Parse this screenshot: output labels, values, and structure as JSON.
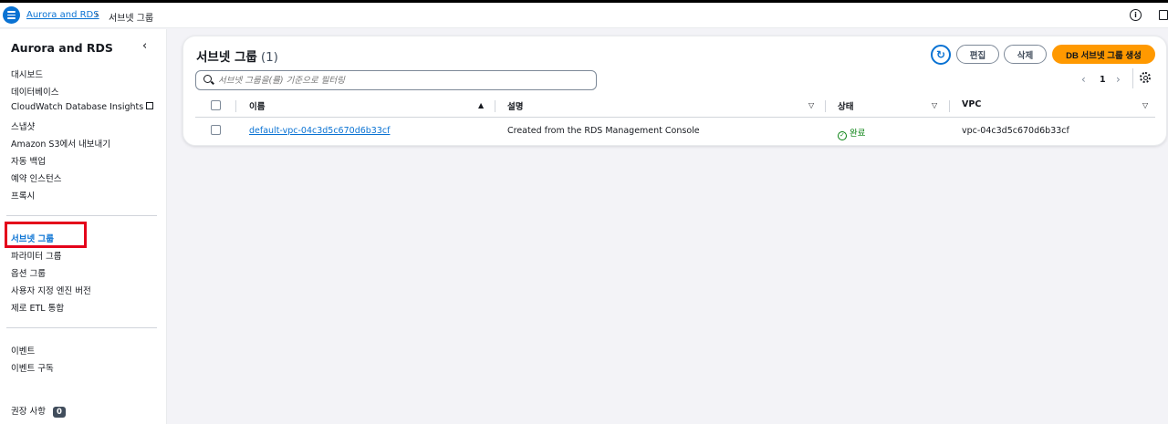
{
  "breadcrumb": {
    "parent": "Aurora and RDS",
    "separator": "›",
    "current": "서브넷 그룹"
  },
  "sidebar": {
    "title": "Aurora and RDS",
    "close_icon": "‹",
    "groups": [
      [
        "대시보드",
        "데이터베이스",
        "CloudWatch Database Insights",
        "스냅샷",
        "Amazon S3에서 내보내기",
        "자동 백업",
        "예약 인스턴스",
        "프록시"
      ],
      [
        "서브넷 그룹",
        "파라미터 그룹",
        "옵션 그룹",
        "사용자 지정 엔진 버전",
        "제로 ETL 통합"
      ],
      [
        "이벤트",
        "이벤트 구독"
      ],
      [
        "권장 사항"
      ]
    ],
    "active_item": "서브넷 그룹",
    "recommendations_count": "0"
  },
  "panel": {
    "title": "서브넷 그룹",
    "count": "(1)",
    "refresh_icon": "refresh-icon",
    "edit_label": "편집",
    "delete_label": "삭제",
    "create_label": "DB 서브넷 그룹 생성",
    "search_placeholder": "서브넷 그룹을(를) 기준으로 필터링",
    "page": "1",
    "prev": "‹",
    "next": "›"
  },
  "table": {
    "columns": [
      "이름",
      "설명",
      "상태",
      "VPC"
    ],
    "rows": [
      {
        "name": "default-vpc-04c3d5c670d6b33cf",
        "description": "Created from the RDS Management Console",
        "status": "완료",
        "vpc": "vpc-04c3d5c670d6b33cf"
      }
    ]
  },
  "colors": {
    "accent": "#0972d3",
    "primary_button": "#ff9900",
    "success": "#037f0c",
    "highlight": "#e4001b"
  }
}
